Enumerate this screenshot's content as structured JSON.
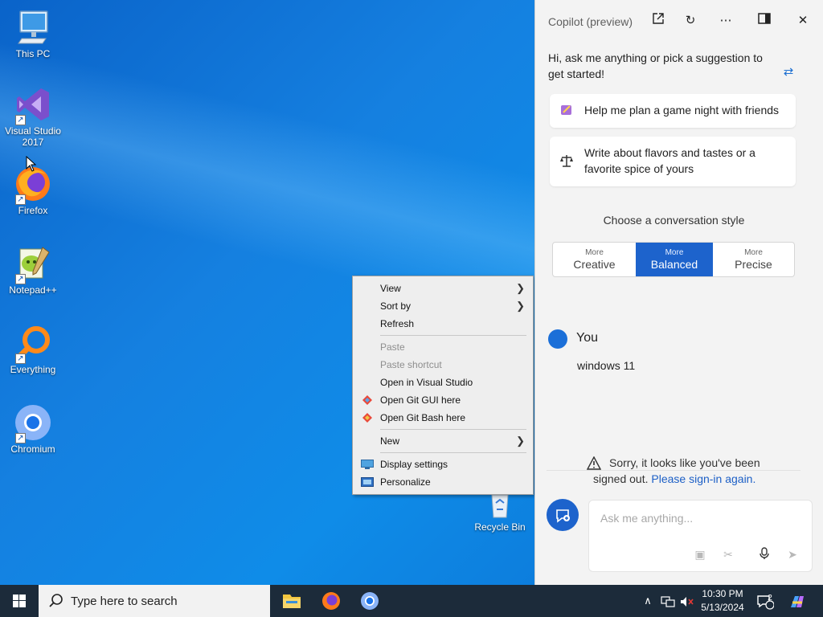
{
  "desktop": {
    "icons": [
      {
        "label": "This PC"
      },
      {
        "label": "Visual Studio 2017"
      },
      {
        "label": "Firefox"
      },
      {
        "label": "Notepad++"
      },
      {
        "label": "Everything"
      },
      {
        "label": "Chromium"
      }
    ],
    "recycle_bin_label": "Recycle Bin"
  },
  "context_menu": {
    "items": [
      {
        "label": "View"
      },
      {
        "label": "Sort by"
      },
      {
        "label": "Refresh"
      },
      {
        "label": "Paste"
      },
      {
        "label": "Paste shortcut"
      },
      {
        "label": "Open in Visual Studio"
      },
      {
        "label": "Open Git GUI here"
      },
      {
        "label": "Open Git Bash here"
      },
      {
        "label": "New"
      },
      {
        "label": "Display settings"
      },
      {
        "label": "Personalize"
      }
    ]
  },
  "copilot": {
    "title": "Copilot (preview)",
    "greeting": "Hi, ask me anything or pick a suggestion to get started!",
    "suggestions": [
      {
        "text": "Help me plan a game night with friends"
      },
      {
        "text": "Write about flavors and tastes or a favorite spice of yours"
      }
    ],
    "style_title": "Choose a conversation style",
    "styles": [
      {
        "small": "More",
        "big": "Creative"
      },
      {
        "small": "More",
        "big": "Balanced"
      },
      {
        "small": "More",
        "big": "Precise"
      }
    ],
    "user_name": "You",
    "user_message": "windows 11",
    "warning_text": "Sorry, it looks like you've been signed out.",
    "warning_link": "Please sign-in again.",
    "ask_placeholder": "Ask me anything..."
  },
  "taskbar": {
    "search_placeholder": "Type here to search",
    "time": "10:30 PM",
    "date": "5/13/2024",
    "notification_count": "2"
  }
}
